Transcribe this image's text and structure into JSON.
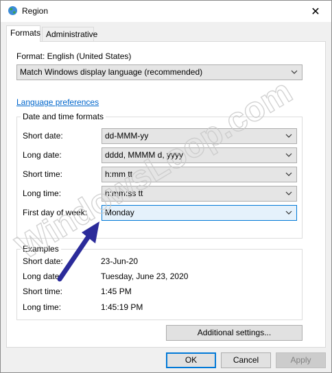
{
  "window": {
    "title": "Region",
    "close_glyph": "✕"
  },
  "tabs": [
    {
      "label": "Formats",
      "active": true
    },
    {
      "label": "Administrative",
      "active": false
    }
  ],
  "format": {
    "label": "Format: English (United States)",
    "value": "Match Windows display language (recommended)"
  },
  "language_link": "Language preferences",
  "datetime": {
    "group_title": "Date and time formats",
    "rows": [
      {
        "label": "Short date:",
        "value": "dd-MMM-yy"
      },
      {
        "label": "Long date:",
        "value": "dddd, MMMM d, yyyy"
      },
      {
        "label": "Short time:",
        "value": "h:mm tt"
      },
      {
        "label": "Long time:",
        "value": "h:mm:ss tt"
      },
      {
        "label": "First day of week:",
        "value": "Monday"
      }
    ]
  },
  "examples": {
    "group_title": "Examples",
    "rows": [
      {
        "label": "Short date:",
        "value": "23-Jun-20"
      },
      {
        "label": "Long date:",
        "value": "Tuesday, June 23, 2020"
      },
      {
        "label": "Short time:",
        "value": "1:45 PM"
      },
      {
        "label": "Long time:",
        "value": "1:45:19 PM"
      }
    ]
  },
  "buttons": {
    "additional": "Additional settings...",
    "ok": "OK",
    "cancel": "Cancel",
    "apply": "Apply"
  },
  "watermark": {
    "text": "WindowsLoop.com"
  },
  "colors": {
    "link": "#0066cc",
    "arrow": "#2b2b9a",
    "focus": "#0078d7"
  }
}
